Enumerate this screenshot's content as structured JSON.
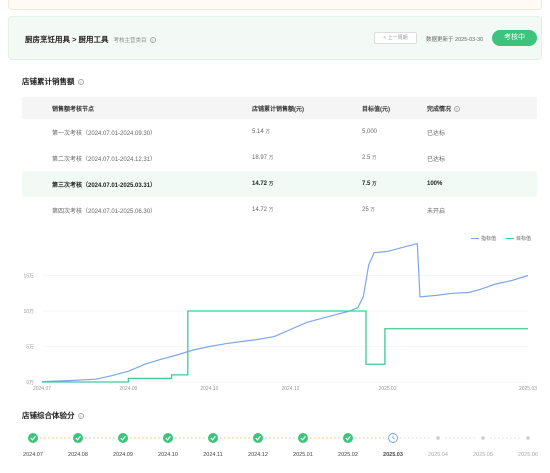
{
  "header": {
    "crumb": "厨房烹饪用具 > 厨用工具",
    "crumb_sub": "考核主营类目",
    "prev_label": "< 上一周期",
    "updated": "数据更新于 2025-03-30",
    "audit_label": "考核中"
  },
  "sales": {
    "title": "店铺累计销售额",
    "columns": [
      "销售额考核节点",
      "店铺累计销售额(元)",
      "目标值(元)",
      "完成情况"
    ],
    "rows": [
      {
        "node": "第一次考核（2024.07.01-2024.09.30）",
        "amount": "5.14",
        "amount_unit": "万",
        "target": "5,000",
        "target_unit": "",
        "status": "已达标"
      },
      {
        "node": "第二次考核（2024.07.01-2024.12.31）",
        "amount": "18.97",
        "amount_unit": "万",
        "target": "2.5",
        "target_unit": "万",
        "status": "已达标"
      },
      {
        "node": "第三次考核（2024.07.01-2025.03.31）",
        "amount": "14.72",
        "amount_unit": "万",
        "target": "7.5",
        "target_unit": "万",
        "status": "100%"
      },
      {
        "node": "第四次考核（2024.07.01-2025.06.30）",
        "amount": "14.72",
        "amount_unit": "万",
        "target": "25",
        "target_unit": "万",
        "status": "未开启"
      }
    ]
  },
  "legend": {
    "actual": "指标值",
    "target": "目标值"
  },
  "colors": {
    "actual": "#7da6ec",
    "target": "#3dcc96",
    "accent": "#3cc47c"
  },
  "chart_data": {
    "type": "line",
    "y_ticks": [
      "0万",
      "5万",
      "10万",
      "15万"
    ],
    "x_ticks": [
      "2024.07",
      "2024.09",
      "2024.10",
      "2024.12",
      "2025.02",
      "2025.03"
    ],
    "ylim": [
      0,
      20
    ],
    "xlim": [
      0,
      9
    ],
    "series": [
      {
        "name": "指标值",
        "points": [
          [
            0,
            0.05
          ],
          [
            0.5,
            0.2
          ],
          [
            1,
            0.4
          ],
          [
            1.3,
            0.9
          ],
          [
            1.6,
            1.5
          ],
          [
            1.9,
            2.5
          ],
          [
            2.2,
            3.2
          ],
          [
            2.5,
            3.8
          ],
          [
            2.8,
            4.5
          ],
          [
            3.1,
            5.0
          ],
          [
            3.4,
            5.4
          ],
          [
            3.7,
            5.7
          ],
          [
            4.0,
            6.0
          ],
          [
            4.3,
            6.4
          ],
          [
            4.6,
            7.4
          ],
          [
            4.9,
            8.4
          ],
          [
            5.2,
            9.0
          ],
          [
            5.5,
            9.6
          ],
          [
            5.7,
            10.0
          ],
          [
            5.85,
            10.5
          ],
          [
            5.95,
            12.0
          ],
          [
            6.05,
            16.5
          ],
          [
            6.15,
            18.2
          ],
          [
            6.4,
            18.4
          ],
          [
            6.7,
            19.0
          ],
          [
            6.95,
            19.5
          ],
          [
            7.0,
            12.0
          ],
          [
            7.3,
            12.2
          ],
          [
            7.6,
            12.5
          ],
          [
            7.9,
            12.6
          ],
          [
            8.1,
            13.0
          ],
          [
            8.4,
            13.8
          ],
          [
            8.7,
            14.3
          ],
          [
            9.0,
            15.0
          ]
        ]
      },
      {
        "name": "目标值",
        "steps": [
          [
            0,
            0
          ],
          [
            1.6,
            0.5
          ],
          [
            2.2,
            0.5
          ],
          [
            2.4,
            1.0
          ],
          [
            2.7,
            10.0
          ],
          [
            5.95,
            10.0
          ],
          [
            6.0,
            2.5
          ],
          [
            6.3,
            2.5
          ],
          [
            6.35,
            7.5
          ],
          [
            9.0,
            7.5
          ]
        ]
      }
    ]
  },
  "composite": {
    "title": "店铺综合体验分",
    "steps": [
      {
        "label": "2024.07",
        "state": "done"
      },
      {
        "label": "2024.08",
        "state": "done"
      },
      {
        "label": "2024.09",
        "state": "done"
      },
      {
        "label": "2024.10",
        "state": "done"
      },
      {
        "label": "2024.11",
        "state": "done"
      },
      {
        "label": "2024.12",
        "state": "done"
      },
      {
        "label": "2025.01",
        "state": "done"
      },
      {
        "label": "2025.02",
        "state": "done"
      },
      {
        "label": "2025.03",
        "state": "current"
      },
      {
        "label": "2025.04",
        "state": "future"
      },
      {
        "label": "2025.05",
        "state": "future"
      },
      {
        "label": "2025.06",
        "state": "future"
      }
    ]
  }
}
